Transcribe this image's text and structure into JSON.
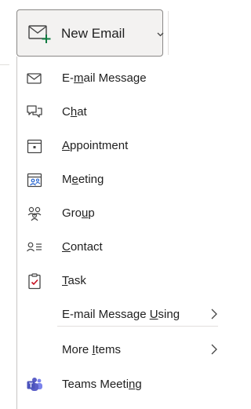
{
  "new_email_button": {
    "label": "New Email",
    "icon": "new-email-icon"
  },
  "menu": {
    "items": [
      {
        "label": "E-mail Message",
        "underline_index": 2,
        "icon": "envelope-icon"
      },
      {
        "label": "Chat",
        "underline_index": 1,
        "icon": "chat-icon"
      },
      {
        "label": "Appointment",
        "underline_index": 0,
        "icon": "appointment-icon"
      },
      {
        "label": "Meeting",
        "underline_index": 1,
        "icon": "meeting-icon"
      },
      {
        "label": "Group",
        "underline_index": 3,
        "icon": "group-icon"
      },
      {
        "label": "Contact",
        "underline_index": 0,
        "icon": "contact-icon"
      },
      {
        "label": "Task",
        "underline_index": 0,
        "icon": "task-icon"
      },
      {
        "label": "E-mail Message Using",
        "underline_index": 15,
        "icon": "",
        "submenu": true
      },
      {
        "label": "More Items",
        "underline_index": 5,
        "icon": "",
        "submenu": true
      },
      {
        "label": "Teams Meeting",
        "underline_index": 11,
        "icon": "teams-icon"
      }
    ]
  },
  "colors": {
    "accent_green": "#107c41",
    "teams_purple": "#5b5fc7",
    "task_red": "#c50f1f",
    "meeting_blue": "#2564cf"
  }
}
